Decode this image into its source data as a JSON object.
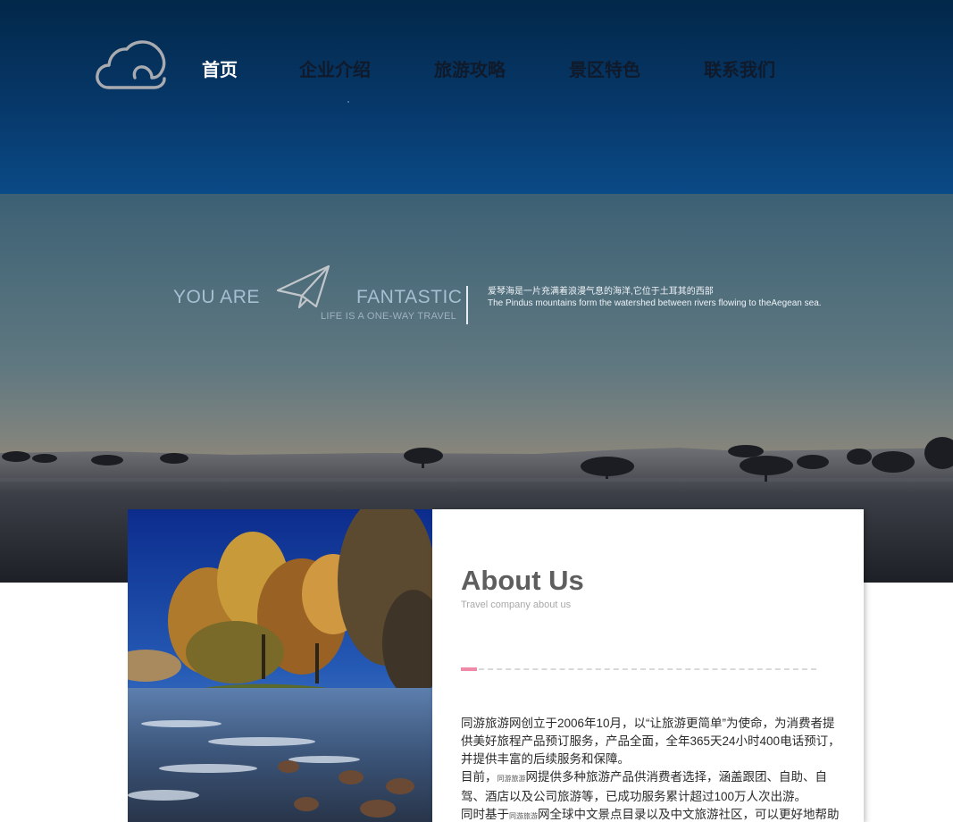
{
  "header": {
    "nav": [
      {
        "label": "首页",
        "active": true
      },
      {
        "label": "企业介绍",
        "active": false
      },
      {
        "label": "旅游攻略",
        "active": false
      },
      {
        "label": "景区特色",
        "active": false
      },
      {
        "label": "联系我们",
        "active": false
      }
    ],
    "logo_icon": "cloud-icon"
  },
  "hero": {
    "tagline_left": "YOU ARE",
    "tagline_right": "FANTASTIC",
    "tagline_sub": "LIFE IS A ONE-WAY TRAVEL",
    "plane_icon": "paper-plane-icon",
    "desc_line1": "爱琴海是一片充满着浪漫气息的海洋,它位于土耳其的西部",
    "desc_line2": "The Pindus mountains form the watershed between rivers flowing to theAegean sea."
  },
  "about": {
    "title": "About Us",
    "subtitle": "Travel company about us",
    "p1": "同游旅游网创立于2006年10月，以“让旅游更简单”为使命，为消费者提供美好旅程产品预订服务，产品全面，全年365天24小时400电话预订，并提供丰富的后续服务和保障。",
    "p2_start": "目前，",
    "p2_mini": "同游旅游",
    "p2_end": "网提供多种旅游产品供消费者选择，涵盖跟团、自助、自驾、酒店以及公司旅游等，已成功服务累计超过100万人次出游。",
    "p3_start": "同时基于",
    "p3_mini": "同游旅游",
    "p3_end": "网全球中文景点目录以及中文旅游社区，可以更好地帮助游"
  },
  "colors": {
    "header_bg": "#07386a",
    "nav_active": "#ffffff",
    "nav_inactive": "#101a2a",
    "accent": "#ee8aa8"
  }
}
